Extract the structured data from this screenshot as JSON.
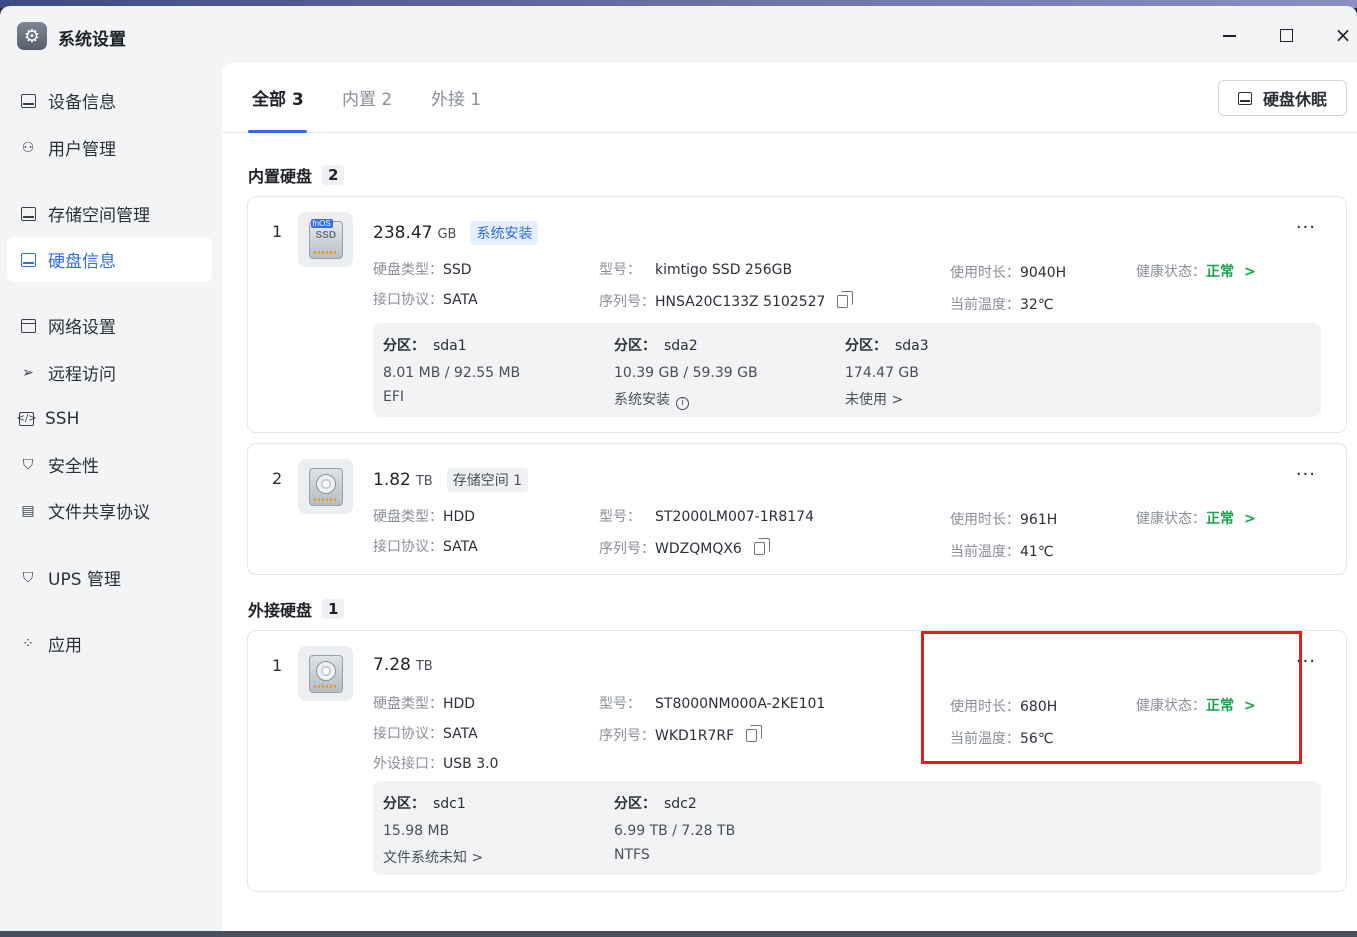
{
  "app": {
    "title": "系统设置",
    "icon": "gear-icon"
  },
  "window_controls": {
    "minimize": "minimize-icon",
    "maximize": "maximize-icon",
    "close": "×"
  },
  "sidebar": {
    "items": [
      {
        "label": "设备信息",
        "icon": "device-icon"
      },
      {
        "label": "用户管理",
        "icon": "user-icon"
      },
      {
        "label": "存储空间管理",
        "icon": "storage-icon"
      },
      {
        "label": "硬盘信息",
        "icon": "disk-icon",
        "active": true
      },
      {
        "label": "网络设置",
        "icon": "network-icon"
      },
      {
        "label": "远程访问",
        "icon": "send-icon"
      },
      {
        "label": "SSH",
        "icon": "terminal-icon"
      },
      {
        "label": "安全性",
        "icon": "shield-check-icon"
      },
      {
        "label": "文件共享协议",
        "icon": "file-icon"
      },
      {
        "label": "UPS 管理",
        "icon": "shield-icon"
      },
      {
        "label": "应用",
        "icon": "apps-icon"
      }
    ]
  },
  "tabs": [
    {
      "label": "全部 3",
      "active": true
    },
    {
      "label": "内置 2"
    },
    {
      "label": "外接 1"
    }
  ],
  "sleep_button": {
    "label": "硬盘休眠"
  },
  "labels": {
    "type": "硬盘类型：",
    "protocol": "接口协议：",
    "model": "型号：",
    "serial": "序列号：",
    "uptime": "使用时长：",
    "temp": "当前温度：",
    "health": "健康状态：",
    "port": "外设接口：",
    "partition": "分区：",
    "more": "···",
    "chevron": ">"
  },
  "internal": {
    "title": "内置硬盘",
    "count": "2",
    "disks": [
      {
        "index": "1",
        "capacity": "238.47",
        "unit": "GB",
        "tag": "系统安装",
        "type": "SSD",
        "protocol": "SATA",
        "model": "kimtigo SSD 256GB",
        "serial": "HNSA20C133Z 5102527",
        "uptime": "9040H",
        "temp": "32℃",
        "health": "正常",
        "icon_badge": "fnOS",
        "icon_text": "SSD",
        "partitions": [
          {
            "name": "sda1",
            "size": "8.01 MB / 92.55 MB",
            "note": "EFI"
          },
          {
            "name": "sda2",
            "size": "10.39 GB / 59.39 GB",
            "note": "系统安装"
          },
          {
            "name": "sda3",
            "size": "174.47 GB",
            "note": "未使用 >"
          }
        ]
      },
      {
        "index": "2",
        "capacity": "1.82",
        "unit": "TB",
        "tag": "存储空间 1",
        "type": "HDD",
        "protocol": "SATA",
        "model": "ST2000LM007-1R8174",
        "serial": "WDZQMQX6",
        "uptime": "961H",
        "temp": "41℃",
        "health": "正常"
      }
    ]
  },
  "external": {
    "title": "外接硬盘",
    "count": "1",
    "disks": [
      {
        "index": "1",
        "capacity": "7.28",
        "unit": "TB",
        "type": "HDD",
        "protocol": "SATA",
        "port": "USB 3.0",
        "model": "ST8000NM000A-2KE101",
        "serial": "WKD1R7RF",
        "uptime": "680H",
        "temp": "56℃",
        "health": "正常",
        "partitions": [
          {
            "name": "sdc1",
            "size": "15.98 MB",
            "note": "文件系统未知 >"
          },
          {
            "name": "sdc2",
            "size": "6.99 TB / 7.28 TB",
            "note": "NTFS"
          }
        ]
      }
    ]
  },
  "colors": {
    "accent": "#2f6ee5",
    "healthy": "#1aa34a",
    "highlight": "#e02020"
  }
}
